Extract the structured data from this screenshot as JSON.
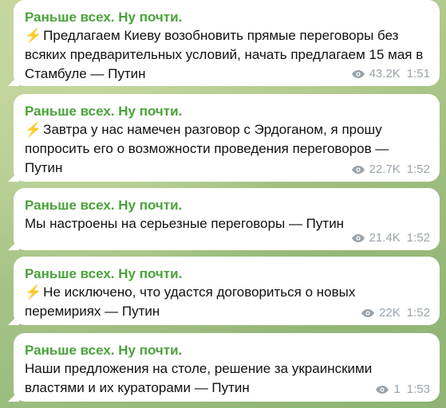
{
  "messages": [
    {
      "sender": "Раньше всех. Ну почти.",
      "icon": "lightning-icon",
      "bolt": "⚡",
      "text": "Предлагаем Киеву возобновить прямые переговоры без всяких предварительных условий, начать предлагаем 15 мая в Стамбуле — Путин",
      "views": "43.2K",
      "time": "1:51"
    },
    {
      "sender": "Раньше всех. Ну почти.",
      "icon": "lightning-icon",
      "bolt": "⚡",
      "text": "Завтра у нас намечен разговор с Эрдоганом, я прошу попросить его о возможности проведения переговоров — Путин",
      "views": "22.7K",
      "time": "1:52"
    },
    {
      "sender": "Раньше всех. Ну почти.",
      "text": "Мы настроены на серьезные переговоры — Путин",
      "views": "21.4K",
      "time": "1:52"
    },
    {
      "sender": "Раньше всех. Ну почти.",
      "icon": "lightning-icon",
      "bolt": "⚡",
      "text": "Не исключено, что удастся договориться о новых перемириях — Путин",
      "views": "22K",
      "time": "1:52"
    },
    {
      "sender": "Раньше всех. Ну почти.",
      "text": "Наши предложения на столе, решение за украинскими властями и их кураторами — Путин",
      "views": "1",
      "time": "1:53"
    }
  ],
  "colors": {
    "sender": "#4aa33a",
    "bubble": "#ffffff",
    "meta": "#9aa3ab",
    "lightning": "#f2a81d"
  }
}
